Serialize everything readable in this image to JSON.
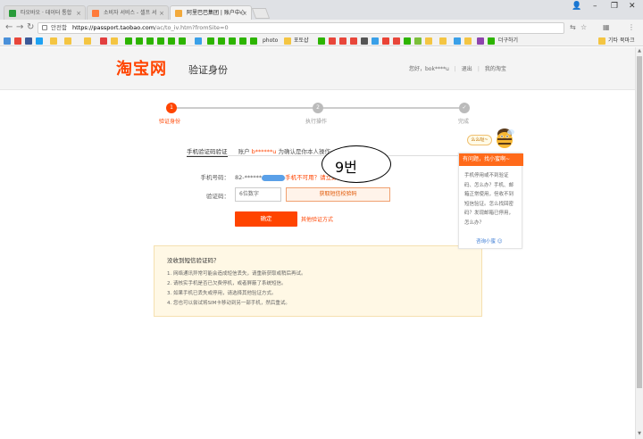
{
  "browser": {
    "tabs": [
      {
        "label": "타오바오 · 데이터 통합",
        "color": "#2a9b3a"
      },
      {
        "label": "소비자 서비스 - 셀프 서",
        "color": "#ff7a3a"
      },
      {
        "label": "阿里巴巴集团 | 账户中心",
        "color": "#f2a93b"
      }
    ],
    "close_label": "×",
    "window_controls": [
      "👤",
      "–",
      "❐",
      "✕"
    ],
    "url_secure_label": "안전함",
    "url_host": "https://passport.taobao.com",
    "url_path": "/ac/to_iv.htm?fromSite=0",
    "bookmark_right": "기타 북마크",
    "bookmark_folder": "포토샵",
    "bookmark_photo": "photo",
    "bookmark_more": "더구하기"
  },
  "header": {
    "logo": "淘宝网",
    "title": "验证身份",
    "greeting": "您好，bok****u",
    "logout": "退出",
    "my_taobao": "我的淘宝"
  },
  "steps": [
    {
      "num": "1",
      "label": "验证身份",
      "active": true
    },
    {
      "num": "2",
      "label": "执行操作",
      "active": false
    },
    {
      "num": "✓",
      "label": "完成",
      "active": false
    }
  ],
  "form": {
    "method_tab": "手机验证码验证",
    "account_prefix": "账户",
    "account_name": "b******u",
    "account_suffix": "为确认是你本人操作",
    "phone_label": "手机号码：",
    "phone_value": "82-******",
    "phone_warn": "手机不可用？请立即更换",
    "code_label": "验证码：",
    "code_placeholder": "6位数字",
    "get_code": "获取短信校验码",
    "confirm": "确定",
    "other_method": "其他验证方式"
  },
  "annotation": {
    "text": "9번"
  },
  "help": {
    "title": "没收到短信验证码？",
    "items": [
      "1. 网络通讯异常可能会造成短信丢失，请重新获取或稍后再试。",
      "2. 请核实手机是否已欠费停机，或者屏蔽了系统短信。",
      "3. 如果手机已丢失或停用，请选择其他验证方式。",
      "4. 您也可以尝试将SIM卡移动到另一部手机，然后重试。"
    ]
  },
  "side": {
    "tag": "么么哒~",
    "head": "有问题，找小蜜啊~",
    "body": "手机停用或不到验证码、怎么办？手机、邮箱正常使用，但收不到短信验证。怎么找回密码？发现邮箱已停用，怎么办？",
    "link": "咨询小蜜 ☺"
  }
}
